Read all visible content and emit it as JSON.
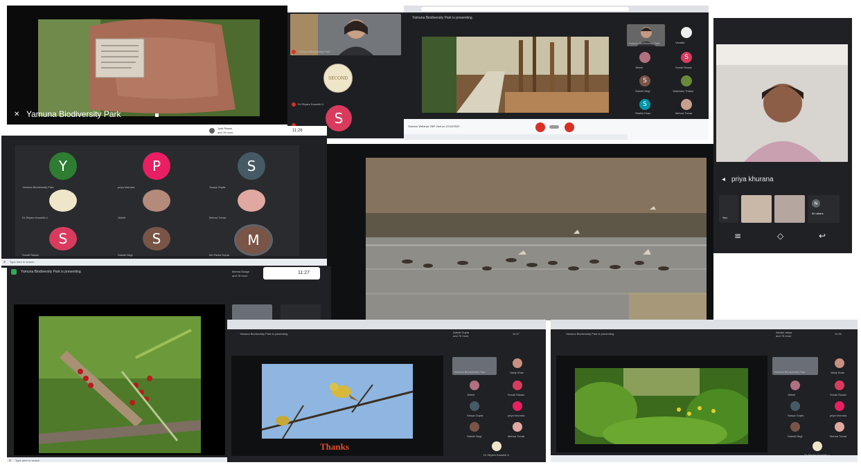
{
  "panel1": {
    "caption": "Yamuna Biodiversity Park"
  },
  "panel2": {
    "participants": [
      {
        "label": "Yamuna Biodiversity Park"
      },
      {
        "label": "Dr Shyam Kaushik U"
      },
      {
        "label": ""
      }
    ],
    "avatar_letter": "S",
    "avatar_color": "#d93b5e"
  },
  "panel3": {
    "presenting": "Yamuna Biodiversity Park is presenting",
    "tab_title": "Science Webinar YBP Visit on 22/10/2020",
    "tiles": [
      {
        "label": "Yamuna Biodiversity Park"
      },
      {
        "label": "Vandita"
      },
      {
        "label": "Jhilmil"
      },
      {
        "label": "Sonali Rawat"
      },
      {
        "label": "Sakshi Negi"
      },
      {
        "label": "Vaishnavi Thakur"
      },
      {
        "label": "Shalini Khan"
      },
      {
        "label": "Mehna Tomar"
      }
    ],
    "avatars": [
      {
        "letter": "S",
        "color": "#d93b5e"
      },
      {
        "letter": "S",
        "color": "#795548"
      },
      {
        "letter": "S",
        "color": "#0097a7"
      }
    ]
  },
  "panel4": {
    "self_name": "priya khurana",
    "you_label": "You",
    "others_label": "50 others",
    "others_letter": "N"
  },
  "panel5": {
    "host_name": "Jyoti Rawat",
    "host_sub": "and 76 more",
    "time": "11:26",
    "search_placeholder": "Type here to search",
    "grid": [
      {
        "letter": "Y",
        "color": "#2e7d32",
        "label": "Yamuna Biodiversity Park"
      },
      {
        "letter": "P",
        "color": "#e91e63",
        "label": "priya khurana"
      },
      {
        "letter": "S",
        "color": "#455a64",
        "label": "Sanya Gupta"
      },
      {
        "letter": "",
        "color": "#ffffff",
        "label": "Dr Shyam Kaushik U"
      },
      {
        "letter": "",
        "color": "#ffffff",
        "label": "Jhilmil"
      },
      {
        "letter": "",
        "color": "#ffffff",
        "label": "Mehna Tomar"
      },
      {
        "letter": "S",
        "color": "#d93b5e",
        "label": "Sonali Rawat"
      },
      {
        "letter": "S",
        "color": "#795548",
        "label": "Sakshi Negi"
      },
      {
        "letter": "M",
        "color": "#795548",
        "label": "Ms Parita Gupta"
      }
    ]
  },
  "panel7": {
    "presenting": "Yamuna Biodiversity Park is presenting",
    "host_name": "Mehna Daage",
    "host_sub": "and 78 more",
    "time": "11:27",
    "search_placeholder": "Type here to search"
  },
  "panel8": {
    "presenting": "Yamuna Biodiversity Park is presenting",
    "thanks": "Thanks",
    "host_name": "Aakriti Gupta",
    "host_sub": "and 76 more",
    "time": "11:37",
    "tiles": [
      {
        "label": "Yamuna Biodiversity Park"
      },
      {
        "label": "Vaidy Khan"
      },
      {
        "label": "Jhilmil"
      },
      {
        "label": "Sonali Rawat"
      },
      {
        "label": "Sanya Gupta"
      },
      {
        "label": "priya khurana"
      },
      {
        "label": "Sakshi Negi"
      },
      {
        "label": "Mehna Tomar"
      },
      {
        "label": "Dr Shyam Kaushik U"
      }
    ]
  },
  "panel9": {
    "presenting": "Yamuna Biodiversity Park is presenting",
    "host_name": "Akhilal Jaliya",
    "host_sub": "and 76 more",
    "time": "11:26",
    "tiles": [
      {
        "label": "Yamuna Biodiversity Park"
      },
      {
        "label": "Vaidy Khan"
      },
      {
        "label": "Jhilmil"
      },
      {
        "label": "Sonali Rawat"
      },
      {
        "label": "Sanya Gupta"
      },
      {
        "label": "priya khurana"
      },
      {
        "label": "Sakshi Negi"
      },
      {
        "label": "Mehna Tomar"
      },
      {
        "label": "Dr Shyam Kaushik U"
      }
    ]
  }
}
